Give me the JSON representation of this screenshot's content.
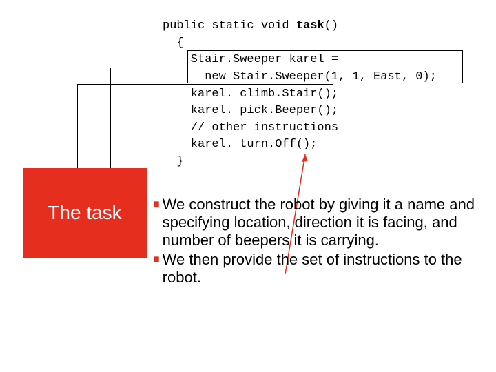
{
  "code": {
    "l1a": "public static void ",
    "l1b": "task",
    "l1c": "()",
    "l2": "  {",
    "l3": "    Stair.Sweeper karel =",
    "l4": "      new Stair.Sweeper(1, 1, East, 0);",
    "l5": "    karel. climb.Stair();",
    "l6": "    karel. pick.Beeper();",
    "l7": "    // other instructions",
    "l8": "    karel. turn.Off();",
    "l9": "  }"
  },
  "title": "The task",
  "bullets": {
    "b1": "We construct the robot by giving it a name and specifying location, direction it is facing, and number of beepers it is carrying.",
    "b2": "We then provide the set of instructions to the robot."
  }
}
